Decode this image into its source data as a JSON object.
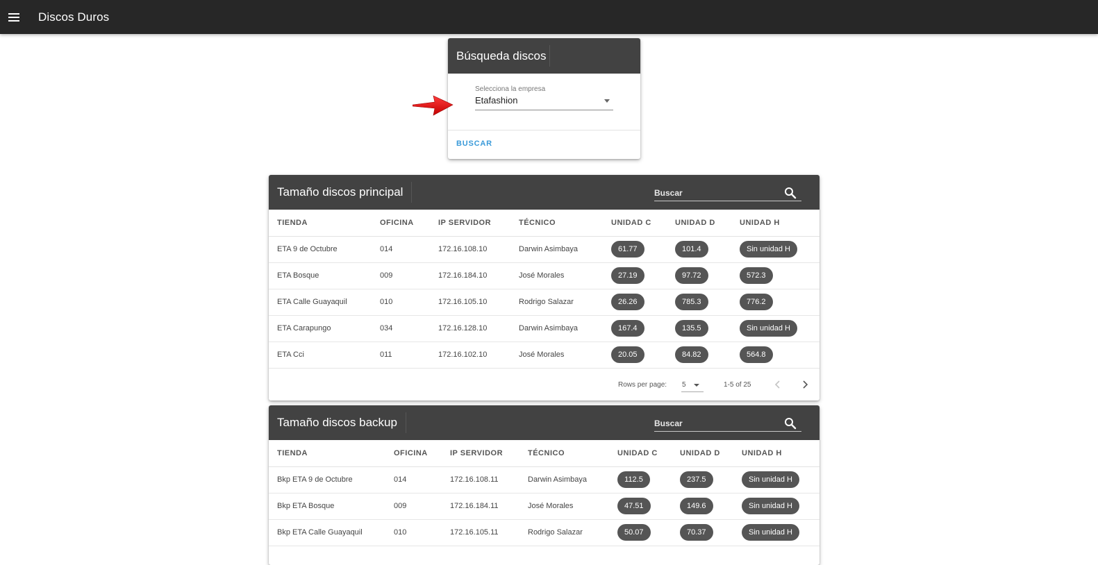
{
  "app": {
    "title": "Discos Duros"
  },
  "search_card": {
    "title": "Búsqueda discos",
    "select_label": "Selecciona la empresa",
    "select_value": "Etafashion",
    "button": "BUSCAR"
  },
  "principal": {
    "title": "Tamaño discos principal",
    "search_placeholder": "Buscar",
    "columns": [
      "TIENDA",
      "OFICINA",
      "IP SERVIDOR",
      "TÉCNICO",
      "UNIDAD C",
      "UNIDAD D",
      "UNIDAD H"
    ],
    "rows": [
      [
        "ETA 9 de Octubre",
        "014",
        "172.16.108.10",
        "Darwin Asimbaya",
        "61.77",
        "101.4",
        "Sin unidad H"
      ],
      [
        "ETA Bosque",
        "009",
        "172.16.184.10",
        "José Morales",
        "27.19",
        "97.72",
        "572.3"
      ],
      [
        "ETA Calle Guayaquil",
        "010",
        "172.16.105.10",
        "Rodrigo Salazar",
        "26.26",
        "785.3",
        "776.2"
      ],
      [
        "ETA Carapungo",
        "034",
        "172.16.128.10",
        "Darwin Asimbaya",
        "167.4",
        "135.5",
        "Sin unidad H"
      ],
      [
        "ETA Cci",
        "011",
        "172.16.102.10",
        "José Morales",
        "20.05",
        "84.82",
        "564.8"
      ]
    ],
    "pagination": {
      "rows_per_page_label": "Rows per page:",
      "rows_per_page": "5",
      "range": "1-5 of 25"
    }
  },
  "backup": {
    "title": "Tamaño discos backup",
    "search_placeholder": "Buscar",
    "columns": [
      "TIENDA",
      "OFICINA",
      "IP SERVIDOR",
      "TÉCNICO",
      "UNIDAD C",
      "UNIDAD D",
      "UNIDAD H"
    ],
    "rows": [
      [
        "Bkp ETA 9 de Octubre",
        "014",
        "172.16.108.11",
        "Darwin Asimbaya",
        "112.5",
        "237.5",
        "Sin unidad H"
      ],
      [
        "Bkp ETA Bosque",
        "009",
        "172.16.184.11",
        "José Morales",
        "47.51",
        "149.6",
        "Sin unidad H"
      ],
      [
        "Bkp ETA Calle Guayaquil",
        "010",
        "172.16.105.11",
        "Rodrigo Salazar",
        "50.07",
        "70.37",
        "Sin unidad H"
      ]
    ]
  },
  "icons": {
    "menu": "menu-icon",
    "search": "search-icon",
    "dropdown": "chevron-down-icon",
    "prev": "chevron-left-icon",
    "next": "chevron-right-icon",
    "annotation": "red-arrow-icon"
  },
  "colors": {
    "topbar": "#272727",
    "card_header": "#424242",
    "chip": "#555555",
    "accent": "#3a9ad9",
    "annotation_arrow": "#e31b1b"
  }
}
